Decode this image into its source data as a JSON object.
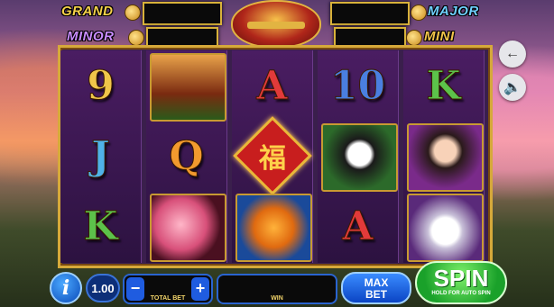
{
  "jackpots": {
    "grand": {
      "label": "GRAND",
      "value": ""
    },
    "major": {
      "label": "MAJOR",
      "value": ""
    },
    "minor": {
      "label": "MINOR",
      "value": ""
    },
    "mini": {
      "label": "MINI",
      "value": ""
    }
  },
  "reels": [
    [
      {
        "type": "letter",
        "text": "9",
        "color": "#f0c64a"
      },
      {
        "type": "letter",
        "text": "J",
        "color": "#4fb2e8"
      },
      {
        "type": "letter",
        "text": "K",
        "color": "#5cc24a"
      }
    ],
    [
      {
        "type": "pic",
        "icon": "pagoda-icon"
      },
      {
        "type": "letter",
        "text": "Q",
        "color": "#f29a2e"
      },
      {
        "type": "pic",
        "icon": "cherry-blossom-icon"
      }
    ],
    [
      {
        "type": "letter",
        "text": "A",
        "color": "#e23a3a"
      },
      {
        "type": "wild",
        "text": "福",
        "icon": "fu-wild-icon"
      },
      {
        "type": "pic",
        "icon": "goldfish-icon"
      }
    ],
    [
      {
        "type": "letter",
        "text": "10",
        "color": "#4a7fe0"
      },
      {
        "type": "pic",
        "icon": "panda-icon"
      },
      {
        "type": "letter",
        "text": "A",
        "color": "#e23a3a"
      }
    ],
    [
      {
        "type": "letter",
        "text": "K",
        "color": "#5cc24a"
      },
      {
        "type": "pic",
        "icon": "princess-icon"
      },
      {
        "type": "pic",
        "icon": "rabbit-icon"
      }
    ]
  ],
  "controls": {
    "info_label": "i",
    "denomination": "1.00",
    "minus_label": "−",
    "plus_label": "+",
    "total_bet_label": "TOTAL BET",
    "total_bet_value": "",
    "win_label": "WIN",
    "win_value": "",
    "max_bet_label_1": "MAX",
    "max_bet_label_2": "BET",
    "spin_label": "SPIN",
    "spin_sub": "HOLD FOR AUTO SPIN"
  },
  "side": {
    "back_icon": "arrow-left-icon",
    "sound_icon": "speaker-icon"
  }
}
